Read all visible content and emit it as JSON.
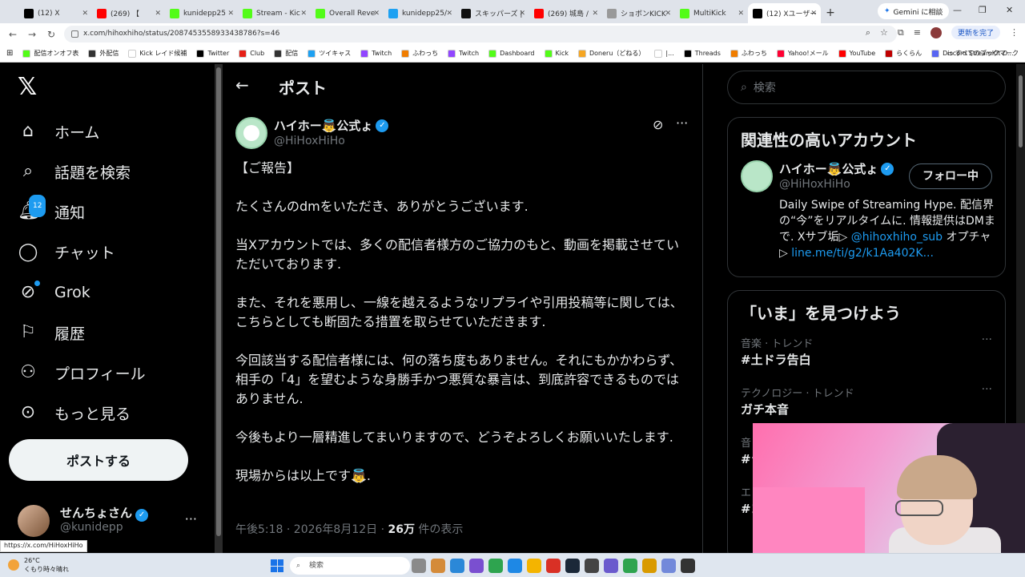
{
  "browser": {
    "tabs": [
      {
        "label": "(12) X",
        "color": "#000000"
      },
      {
        "label": "(269) 【",
        "color": "#ff0000"
      },
      {
        "label": "kunidepp25",
        "color": "#53fc18"
      },
      {
        "label": "Stream - Kic",
        "color": "#53fc18"
      },
      {
        "label": "Overall Reve",
        "color": "#53fc18"
      },
      {
        "label": "kunidepp25/",
        "color": "#1da1f2"
      },
      {
        "label": "スキッパーズ |",
        "color": "#111111"
      },
      {
        "label": "(269) 城島 /",
        "color": "#ff0000"
      },
      {
        "label": "ショボンKICK",
        "color": "#999999"
      },
      {
        "label": "MultiKick",
        "color": "#53fc18"
      },
      {
        "label": "(12) Xユーザー",
        "color": "#000000"
      }
    ],
    "gemini_label": "Gemini に相談",
    "url": "x.com/hihoxhiho/status/2087453558933438786?s=46",
    "update_label": "更新を完了",
    "bookmarks": [
      {
        "label": "配信オンオフ表",
        "color": "#53fc18"
      },
      {
        "label": "外配信",
        "color": "#333333"
      },
      {
        "label": "Kick レイド候補",
        "color": "#ffffff"
      },
      {
        "label": "Twitter",
        "color": "#000000"
      },
      {
        "label": "Club",
        "color": "#e62117"
      },
      {
        "label": "配信",
        "color": "#333333"
      },
      {
        "label": "ツイキャス",
        "color": "#1da1f2"
      },
      {
        "label": "Twitch",
        "color": "#9146ff"
      },
      {
        "label": "ふわっち",
        "color": "#f07d00"
      },
      {
        "label": "Twitch",
        "color": "#9146ff"
      },
      {
        "label": "Dashboard",
        "color": "#53fc18"
      },
      {
        "label": "Kick",
        "color": "#53fc18"
      },
      {
        "label": "Doneru（どねる）",
        "color": "#f5a623"
      },
      {
        "label": "|...",
        "color": "#ffffff"
      },
      {
        "label": "Threads",
        "color": "#000000"
      },
      {
        "label": "ふわっち",
        "color": "#f07d00"
      },
      {
        "label": "Yahoo!メール",
        "color": "#ff0033"
      },
      {
        "label": "YouTube",
        "color": "#ff0000"
      },
      {
        "label": "らくらん",
        "color": "#bf0000"
      },
      {
        "label": "Discord StreamKit O...",
        "color": "#5865f2"
      }
    ],
    "all_bookmarks": "すべてのブックマーク",
    "status_link": "https://x.com/HiHoxHiHo"
  },
  "left_nav": {
    "items": [
      {
        "label": "ホーム",
        "icon": "home-icon"
      },
      {
        "label": "話題を検索",
        "icon": "search-icon"
      },
      {
        "label": "通知",
        "icon": "bell-icon",
        "badge": "12"
      },
      {
        "label": "チャット",
        "icon": "chat-icon"
      },
      {
        "label": "Grok",
        "icon": "grok-icon"
      },
      {
        "label": "履歴",
        "icon": "bookmark-icon"
      },
      {
        "label": "プロフィール",
        "icon": "person-icon"
      },
      {
        "label": "もっと見る",
        "icon": "more-circle-icon"
      }
    ],
    "post_button": "ポストする",
    "me": {
      "name": "せんちょさん",
      "handle": "@kunidepp"
    }
  },
  "post": {
    "header_title": "ポスト",
    "author": {
      "name": "ハイホー👼公式ょ",
      "handle": "@HiHoxHiHo"
    },
    "paragraphs": [
      "【ご報告】",
      "たくさんのdmをいただき、ありがとうございます.",
      "当Xアカウントでは、多くの配信者様方のご協力のもと、動画を掲載させていただいております.",
      "また、それを悪用し、一線を越えるようなリプライや引用投稿等に関しては、こちらとしても断固たる措置を取らせていただきます.",
      "今回該当する配信者様には、何の落ち度もありません。それにもかかわらず、相手の「4」を望むような身勝手かつ悪質な暴言は、到底許容できるものではありません.",
      "今後もより一層精進してまいりますので、どうぞよろしくお願いいたします.",
      "現場からは以上です👼."
    ],
    "time": "午後5:18 · 2026年8月12日 · ",
    "views": "26万",
    "views_suffix": " 件の表示"
  },
  "right": {
    "search_placeholder": "検索",
    "related_title": "関連性の高いアカウント",
    "account": {
      "name": "ハイホー👼公式ょ",
      "handle": "@HiHoxHiHo",
      "follow_label": "フォロー中",
      "bio_text": "Daily Swipe of Streaming Hype. 配信界の“今”をリアルタイムに. 情報提供はDMまで. Xサブ垢▷ ",
      "bio_link1": "@hihoxhiho_sub",
      "bio_mid": " オプチャ▷ ",
      "bio_link2": "line.me/ti/g2/k1Aa402K..."
    },
    "trends_title": "「いま」を見つけよう",
    "trends": [
      {
        "category": "音楽 · トレンド",
        "name": "#土ドラ告白"
      },
      {
        "category": "テクノロジー · トレンド",
        "name": "ガチ本音"
      },
      {
        "category": "音",
        "name": "#ラ"
      },
      {
        "category": "エ",
        "name": "#コ"
      }
    ]
  },
  "taskbar": {
    "weather_temp": "26°C",
    "weather_desc": "くもり時々晴れ",
    "search_label": "検索"
  }
}
